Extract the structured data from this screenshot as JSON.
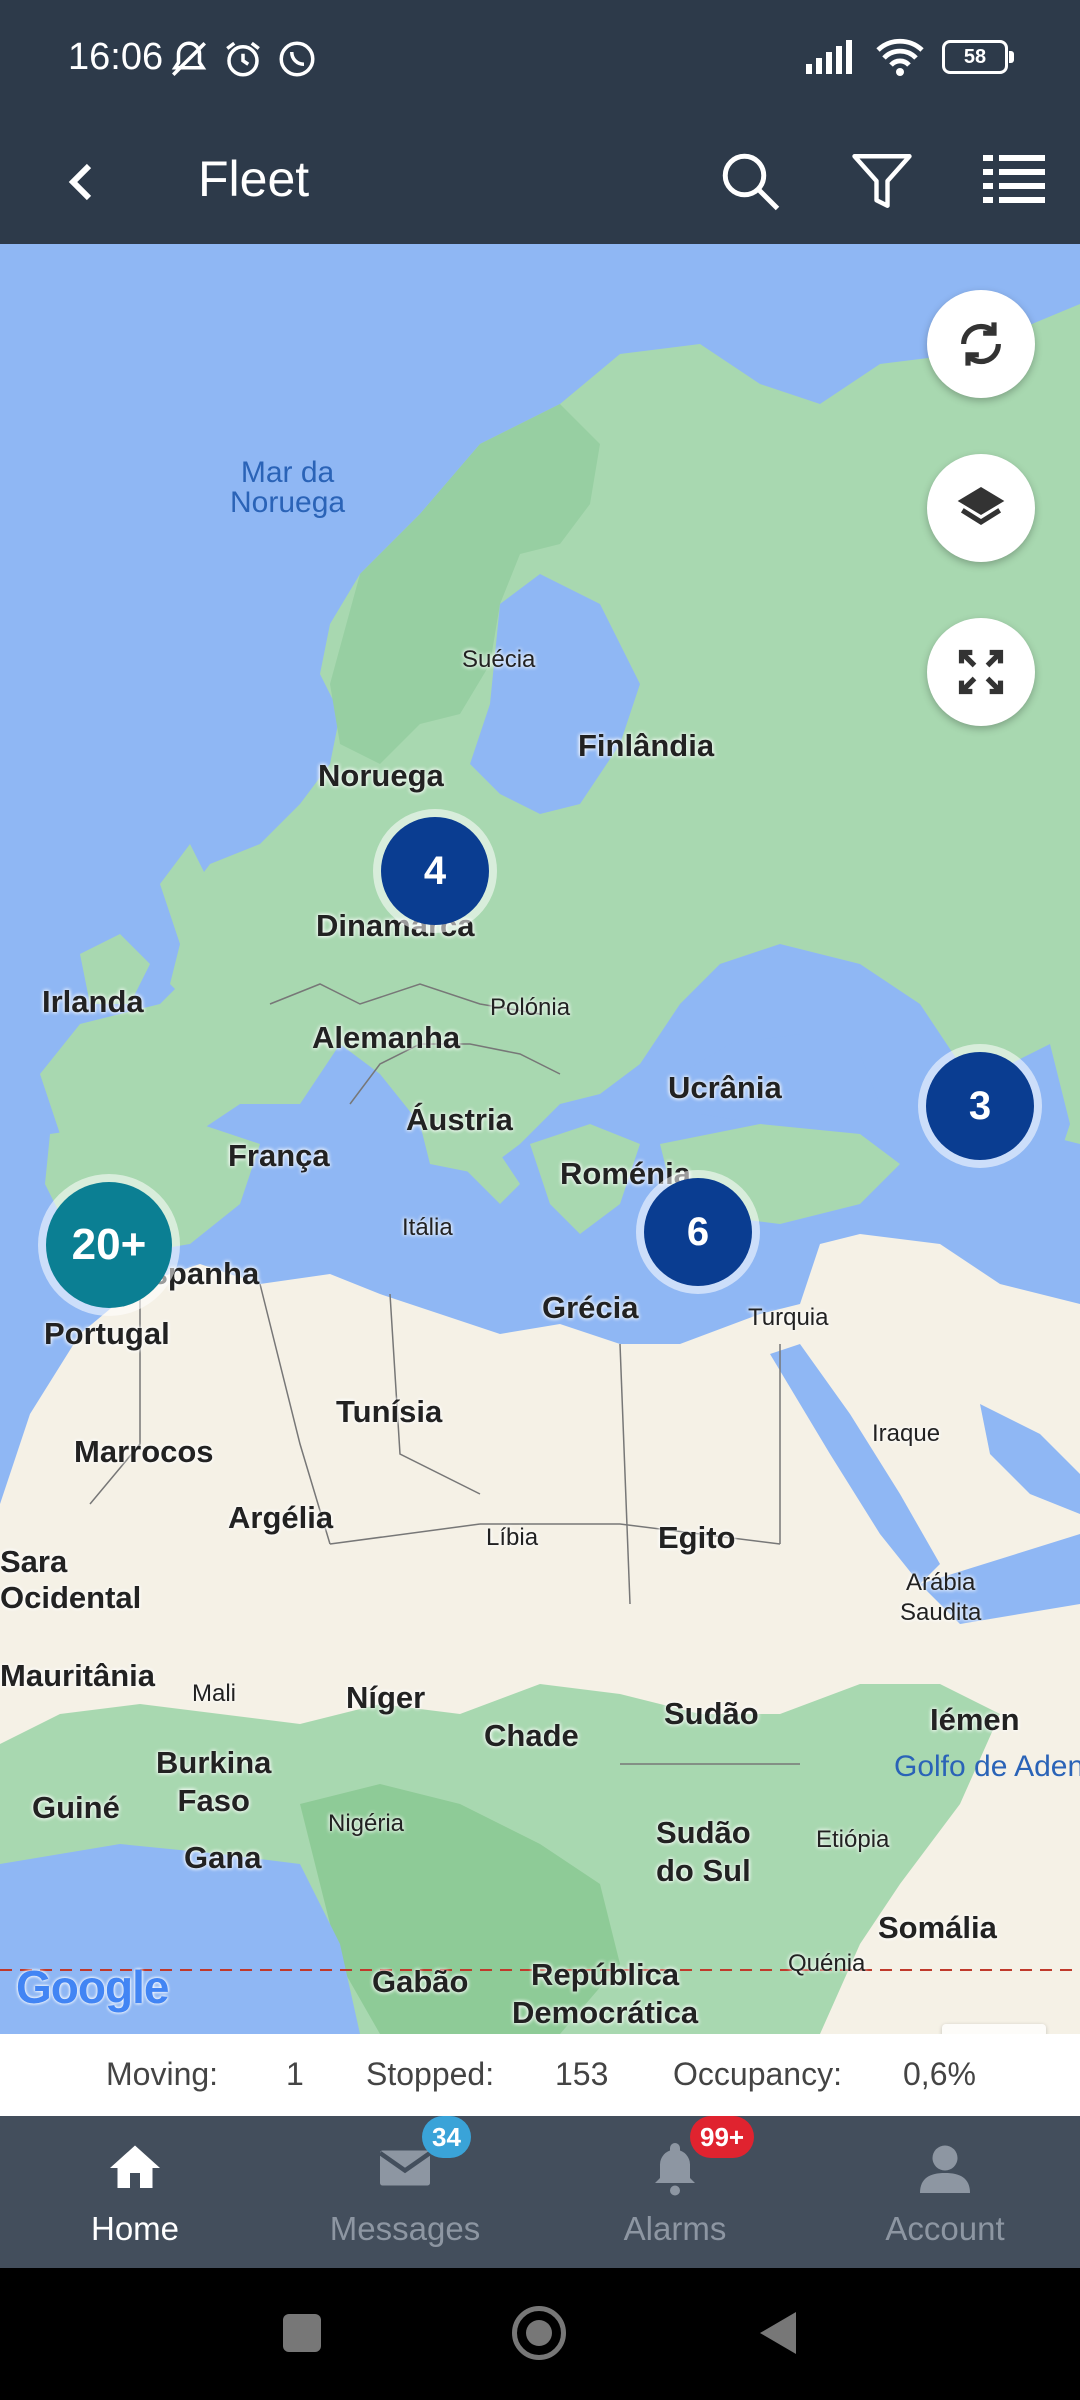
{
  "status_bar": {
    "time": "16:06",
    "battery": "58"
  },
  "app_bar": {
    "title": "Fleet"
  },
  "map": {
    "labels": {
      "mar_noruega": "Mar da\nNoruega",
      "suecia": "Suécia",
      "finlandia": "Finlândia",
      "noruega": "Noruega",
      "dinamarca": "Dinamarca",
      "irlanda": "Irlanda",
      "polonia": "Polónia",
      "alemanha": "Alemanha",
      "ucrania": "Ucrânia",
      "austria": "Áustria",
      "franca": "França",
      "romenia": "Roménia",
      "italia": "Itália",
      "espanha": "Espanha",
      "portugal": "Portugal",
      "grecia": "Grécia",
      "turquia": "Turquia",
      "tunisia": "Tunísia",
      "marrocos": "Marrocos",
      "iraque": "Iraque",
      "argelia": "Argélia",
      "libia": "Líbia",
      "egito": "Egito",
      "sara_ocidental": "Sara\nOcidental",
      "arabia_saudita": "Arábia\nSaudita",
      "mauritania": "Mauritânia",
      "mali": "Mali",
      "niger": "Níger",
      "chade": "Chade",
      "sudao": "Sudão",
      "iemen": "Iémen",
      "golfo_aden": "Golfo de Aden",
      "burkina_faso": "Burkina\nFaso",
      "guine": "Guiné",
      "gana": "Gana",
      "nigeria": "Nigéria",
      "sudao_sul": "Sudão\ndo Sul",
      "etiopia": "Etiópia",
      "somalia": "Somália",
      "gabao": "Gabão",
      "republica_democratica": "República\nDemocrática",
      "quenia": "Quénia"
    },
    "clusters": [
      {
        "count": "4",
        "color": "#0a3d91"
      },
      {
        "count": "3",
        "color": "#0a3d91"
      },
      {
        "count": "20+",
        "color": "#0b7f93"
      },
      {
        "count": "6",
        "color": "#0a3d91"
      }
    ],
    "zoom_in": "+",
    "zoom_out": "−",
    "attribution": "Google"
  },
  "stats": {
    "moving_label": "Moving:",
    "moving_value": "1",
    "stopped_label": "Stopped:",
    "stopped_value": "153",
    "occupancy_label": "Occupancy:",
    "occupancy_value": "0,6%"
  },
  "bottom_nav": {
    "home": "Home",
    "messages": "Messages",
    "messages_badge": "34",
    "alarms": "Alarms",
    "alarms_badge": "99+",
    "account": "Account"
  },
  "colors": {
    "app_bar": "#2d3a4a",
    "nav_bar": "#434e5c",
    "sea": "#8fb7f4",
    "land_green": "#a8d8b0",
    "land_desert": "#f5f1e6",
    "messages_badge": "#3aa3d8",
    "alarms_badge": "#e0232f"
  }
}
